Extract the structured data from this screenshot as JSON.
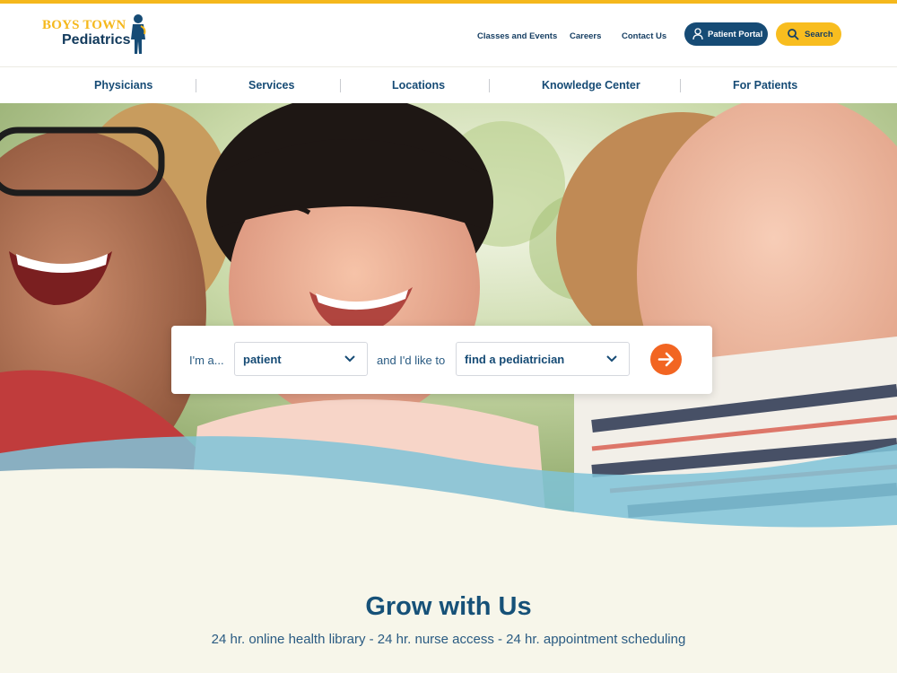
{
  "brand": {
    "name_line1": "BOYS TOWN",
    "name_line2": "Pediatrics",
    "colors": {
      "accent_yellow": "#f5b81c",
      "navy": "#164b75",
      "orange": "#f26522",
      "cream": "#f7f6ea"
    }
  },
  "utility_nav": {
    "links": [
      "Classes and Events",
      "Careers",
      "Contact Us"
    ],
    "portal_label": "Patient Portal",
    "portal_icon": "user-icon",
    "search_label": "Search",
    "search_icon": "search-icon"
  },
  "main_nav": {
    "items": [
      "Physicians",
      "Services",
      "Locations",
      "Knowledge Center",
      "For Patients"
    ]
  },
  "finder": {
    "prefix": "I'm a...",
    "role_value": "patient",
    "middle": "and I'd like to",
    "action_value": "find a pediatrician",
    "go_icon": "arrow-right-icon"
  },
  "promo": {
    "title": "Grow with Us",
    "subtitle": "24 hr. online health library - 24 hr. nurse access - 24 hr. appointment scheduling"
  }
}
